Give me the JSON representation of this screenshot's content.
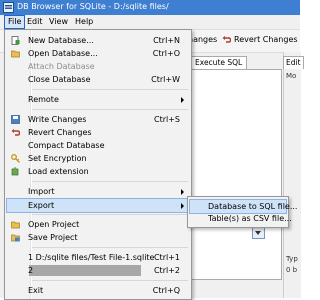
{
  "window": {
    "title": "DB Browser for SQLite - D:/sqlite files/"
  },
  "menubar": {
    "file": "File",
    "edit": "Edit",
    "view": "View",
    "help": "Help"
  },
  "toolbar": {
    "write_changes": "hanges",
    "revert_changes": "Revert Changes"
  },
  "tabs": {
    "execute_sql": "Execute SQL",
    "edit": "Edit"
  },
  "right_panel": {
    "mode": "Mo",
    "type": "Typ",
    "size": "0 b"
  },
  "file_menu": {
    "new_database": {
      "label": "New Database...",
      "shortcut": "Ctrl+N"
    },
    "open_database": {
      "label": "Open Database...",
      "shortcut": "Ctrl+O"
    },
    "attach_database": {
      "label": "Attach Database"
    },
    "close_database": {
      "label": "Close Database",
      "shortcut": "Ctrl+W"
    },
    "remote": {
      "label": "Remote"
    },
    "write_changes": {
      "label": "Write Changes",
      "shortcut": "Ctrl+S"
    },
    "revert_changes": {
      "label": "Revert Changes"
    },
    "compact_database": {
      "label": "Compact Database"
    },
    "set_encryption": {
      "label": "Set Encryption"
    },
    "load_extension": {
      "label": "Load extension"
    },
    "import": {
      "label": "Import"
    },
    "export": {
      "label": "Export"
    },
    "open_project": {
      "label": "Open Project"
    },
    "save_project": {
      "label": "Save Project"
    },
    "recent_1": {
      "label": "1 D:/sqlite files/Test File-1.sqlite",
      "shortcut": "Ctrl+1"
    },
    "recent_2": {
      "label": "2",
      "shortcut": "Ctrl+2"
    },
    "exit": {
      "label": "Exit",
      "shortcut": "Ctrl+Q"
    }
  },
  "export_submenu": {
    "to_sql": "Database to SQL file...",
    "to_csv": "Table(s) as CSV file..."
  },
  "colors": {
    "titlebar": "#3e7fd1",
    "highlight": "#cfe3f8",
    "highlight_border": "#8db2e3"
  }
}
